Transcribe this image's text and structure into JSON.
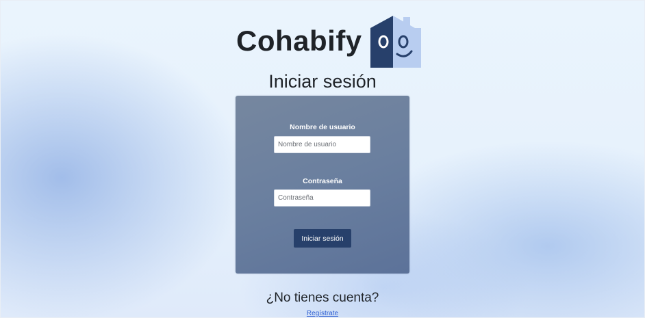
{
  "brand": {
    "name": "Cohabify"
  },
  "page": {
    "title": "Iniciar sesión"
  },
  "form": {
    "username_label": "Nombre de usuario",
    "username_placeholder": "Nombre de usuario",
    "password_label": "Contraseña",
    "password_placeholder": "Contraseña",
    "submit_label": "Iniciar sesión"
  },
  "footer": {
    "prompt": "¿No tienes cuenta?",
    "register_link": "Regístrate"
  },
  "icons": {
    "logo": "smiling-house-icon"
  },
  "colors": {
    "card": "#6a7f9f",
    "button": "#27406b",
    "logo_dark": "#27406b",
    "logo_light": "#b8cdf0",
    "link": "#2f5fd1"
  }
}
